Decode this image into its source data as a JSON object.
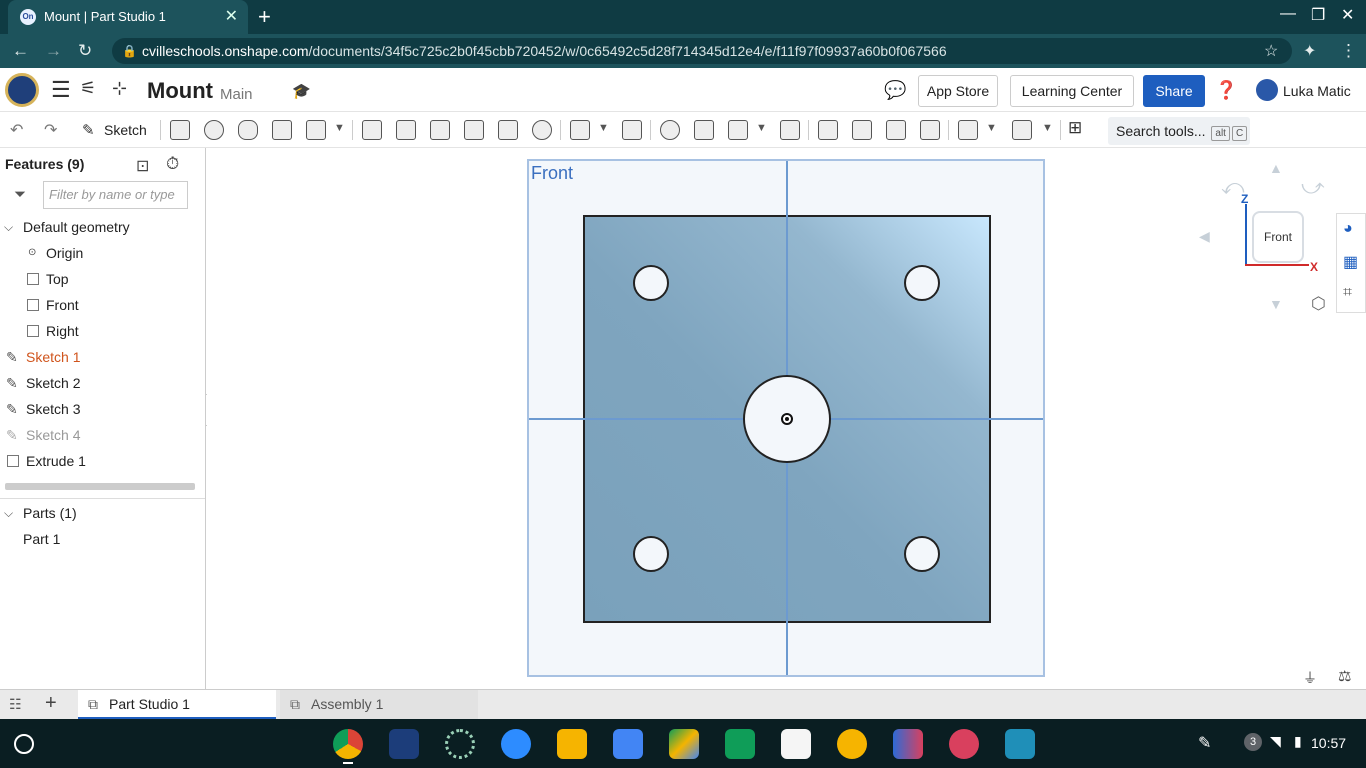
{
  "browser": {
    "tab_title": "Mount | Part Studio 1",
    "tab_favicon": "On",
    "url_host": "cvilleschools.onshape.com",
    "url_path": "/documents/34f5c725c2b0f45cbb720452/w/0c65492c5d28f714345d12e4/e/f11f97f09937a60b0f067566"
  },
  "header": {
    "doc_title": "Mount",
    "branch": "Main",
    "app_store": "App Store",
    "learning_center": "Learning Center",
    "share": "Share",
    "user": "Luka Matic"
  },
  "toolbar": {
    "sketch": "Sketch",
    "search": "Search tools...",
    "kbd_alt": "alt",
    "kbd_c": "C"
  },
  "features": {
    "title": "Features (9)",
    "filter_placeholder": "Filter by name or type",
    "default_geometry": "Default geometry",
    "items": [
      {
        "label": "Origin"
      },
      {
        "label": "Top"
      },
      {
        "label": "Front"
      },
      {
        "label": "Right"
      },
      {
        "label": "Sketch 1"
      },
      {
        "label": "Sketch 2"
      },
      {
        "label": "Sketch 3"
      },
      {
        "label": "Sketch 4"
      },
      {
        "label": "Extrude 1"
      }
    ],
    "parts_title": "Parts (1)",
    "parts": [
      {
        "label": "Part 1"
      }
    ]
  },
  "viewport": {
    "plane_label": "Front",
    "cube_label": "Front",
    "axis_z": "Z",
    "axis_x": "X"
  },
  "bottom_tabs": {
    "part_studio": "Part Studio 1",
    "assembly": "Assembly 1"
  },
  "shelf": {
    "notification_count": "3",
    "time": "10:57"
  },
  "colors": {
    "accent": "#1e5ebf",
    "sketch_active": "#d0541c",
    "sketch_hidden": "#999999"
  }
}
